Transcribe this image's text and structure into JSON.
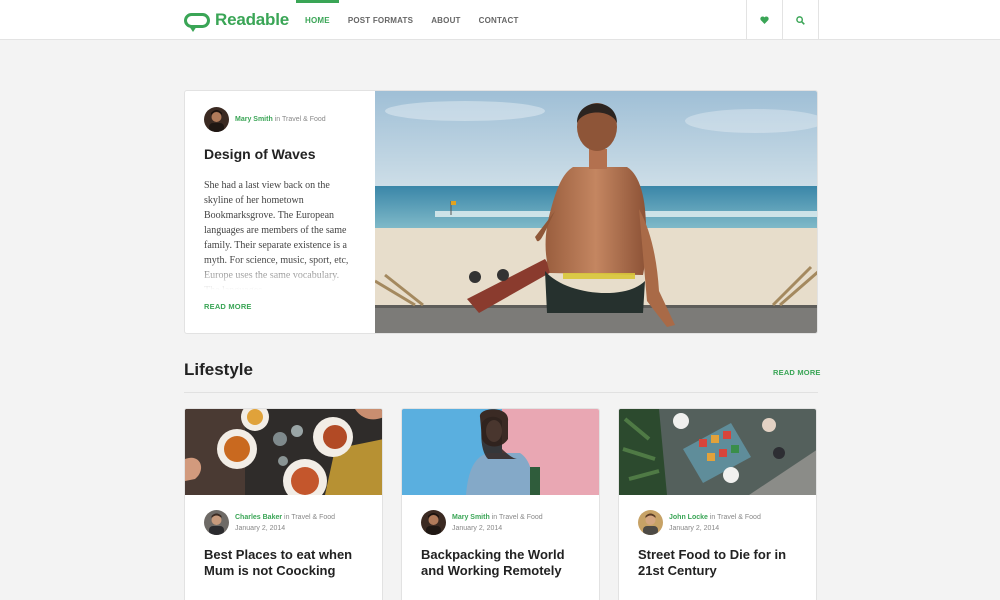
{
  "brand": {
    "name": "Readable",
    "accent": "#3aa556"
  },
  "nav": {
    "items": [
      {
        "label": "HOME",
        "active": true
      },
      {
        "label": "POST FORMATS"
      },
      {
        "label": "ABOUT"
      },
      {
        "label": "CONTACT"
      }
    ]
  },
  "header_icons": [
    "heart-icon",
    "search-icon"
  ],
  "featured": {
    "author": "Mary Smith",
    "in": "in",
    "category": "Travel & Food",
    "title": "Design of Waves",
    "excerpt": "She had a last view back on the skyline of her hometown Bookmarksgrove. The European languages are members of the same family. Their separate existence is a myth. For science, music, sport, etc, Europe uses the same vocabulary. The languages",
    "read_more": "READ MORE"
  },
  "section": {
    "title": "Lifestyle",
    "read_more": "READ MORE"
  },
  "posts": [
    {
      "author": "Charles Baker",
      "in": "in",
      "category": "Travel & Food",
      "date": "January 2, 2014",
      "title": "Best Places to eat when Mum is not Coocking"
    },
    {
      "author": "Mary Smith",
      "in": "in",
      "category": "Travel & Food",
      "date": "January 2, 2014",
      "title": "Backpacking the World and Working Remotely"
    },
    {
      "author": "John Locke",
      "in": "in",
      "category": "Travel & Food",
      "date": "January 2, 2014",
      "title": "Street Food to Die for in 21st Century"
    }
  ]
}
